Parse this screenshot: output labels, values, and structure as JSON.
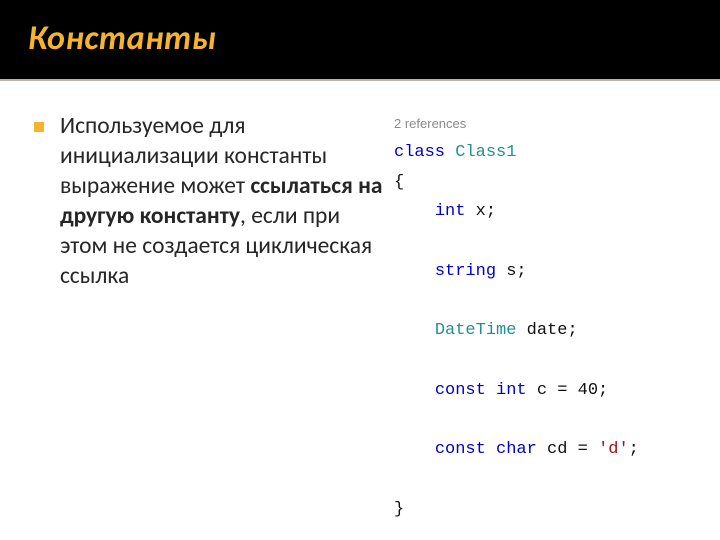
{
  "title": "Константы",
  "bullet": {
    "pre": "Используемое для инициализации константы выражение может ",
    "bold": "ссылаться на другую константу",
    "post": ", если при этом не создается циклическая ссылка"
  },
  "code": {
    "refs": "2 references",
    "kw_class": "class",
    "classname": "Class1",
    "open": "{",
    "indent": "    ",
    "kw_int": "int",
    "decl_x": " x;",
    "kw_string": "string",
    "decl_s": " s;",
    "type_date": "DateTime",
    "decl_date": " date;",
    "kw_const1": "const",
    "kw_int2": "int",
    "decl_c": " c = 40;",
    "kw_const2": "const",
    "kw_char": "char",
    "decl_cd_pre": " cd = ",
    "chr_d": "'d'",
    "decl_cd_post": ";",
    "close": "}"
  }
}
